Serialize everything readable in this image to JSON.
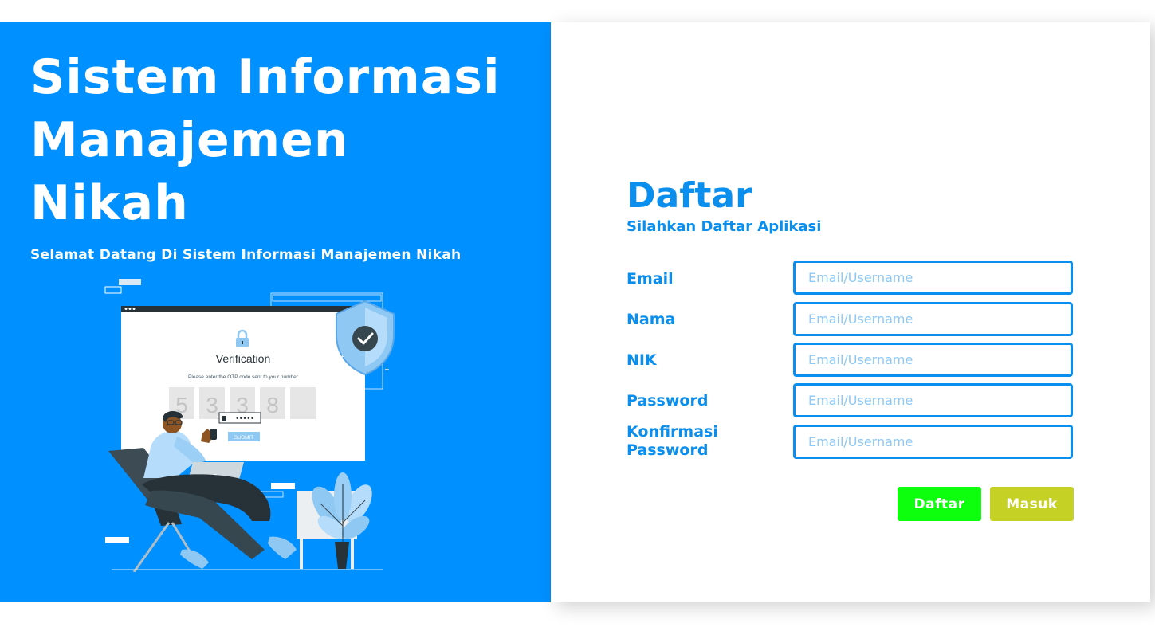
{
  "hero": {
    "title_lines": [
      "Sistem Informasi",
      "Manajemen",
      "Nikah"
    ],
    "subtitle": "Selamat Datang Di Sistem Informasi Manajemen Nikah"
  },
  "illustration": {
    "card_title": "Verification",
    "card_text": "Please enter the OTP code sent to your number",
    "otp_digits": [
      "5",
      "3",
      "3",
      "8",
      ""
    ],
    "password_dots": "•••••",
    "submit_label": "SUBMIT"
  },
  "form": {
    "title": "Daftar",
    "subtitle": "Silahkan Daftar Aplikasi",
    "fields": [
      {
        "label": "Email",
        "placeholder": "Email/Username"
      },
      {
        "label": "Nama",
        "placeholder": "Email/Username"
      },
      {
        "label": "NIK",
        "placeholder": "Email/Username"
      },
      {
        "label": "Password",
        "placeholder": "Email/Username"
      },
      {
        "label": "Konfirmasi Password",
        "placeholder": "Email/Username"
      }
    ],
    "buttons": {
      "register_label": "Daftar",
      "login_label": "Masuk"
    }
  },
  "colors": {
    "hero_background": "#0090ff",
    "primary_text": "#0a8fef",
    "register_button": "#0dff0d",
    "login_button": "#c6d126"
  }
}
